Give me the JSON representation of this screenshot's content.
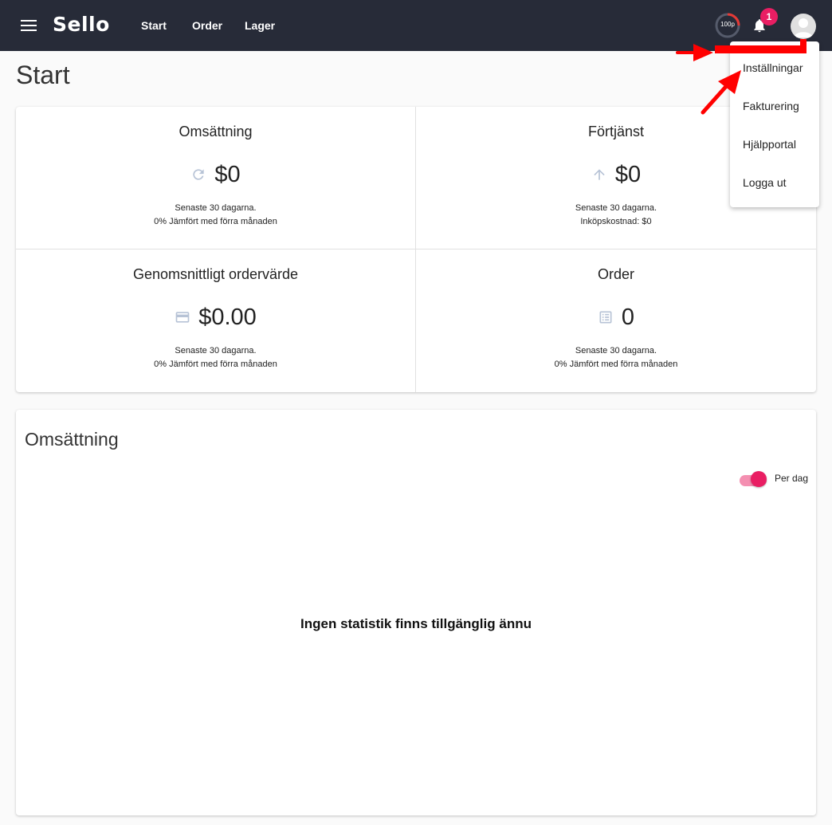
{
  "header": {
    "logo": "Sello",
    "nav": [
      {
        "label": "Start"
      },
      {
        "label": "Order"
      },
      {
        "label": "Lager"
      }
    ],
    "points_label": "100p",
    "notification_count": "1"
  },
  "page": {
    "title": "Start"
  },
  "stats": [
    {
      "title": "Omsättning",
      "icon": "refresh-icon",
      "value": "$0",
      "line1": "Senaste 30 dagarna.",
      "line2": "0% Jämfört med förra månaden"
    },
    {
      "title": "Förtjänst",
      "icon": "arrow-up-icon",
      "value": "$0",
      "line1": "Senaste 30 dagarna.",
      "line2": "Inköpskostnad: $0"
    },
    {
      "title": "Genomsnittligt ordervärde",
      "icon": "credit-card-icon",
      "value": "$0.00",
      "line1": "Senaste 30 dagarna.",
      "line2": "0% Jämfört med förra månaden"
    },
    {
      "title": "Order",
      "icon": "list-icon",
      "value": "0",
      "line1": "Senaste 30 dagarna.",
      "line2": "0% Jämfört med förra månaden"
    }
  ],
  "revenue": {
    "title": "Omsättning",
    "toggle_label": "Per dag",
    "toggle_on": true,
    "empty_message": "Ingen statistik finns tillgänglig ännu"
  },
  "user_menu": {
    "items": [
      {
        "label": "Inställningar"
      },
      {
        "label": "Fakturering"
      },
      {
        "label": "Hjälpportal"
      },
      {
        "label": "Logga ut"
      }
    ]
  },
  "colors": {
    "topbar": "#272b38",
    "accent": "#e91e63",
    "annotation": "#ff0000"
  }
}
